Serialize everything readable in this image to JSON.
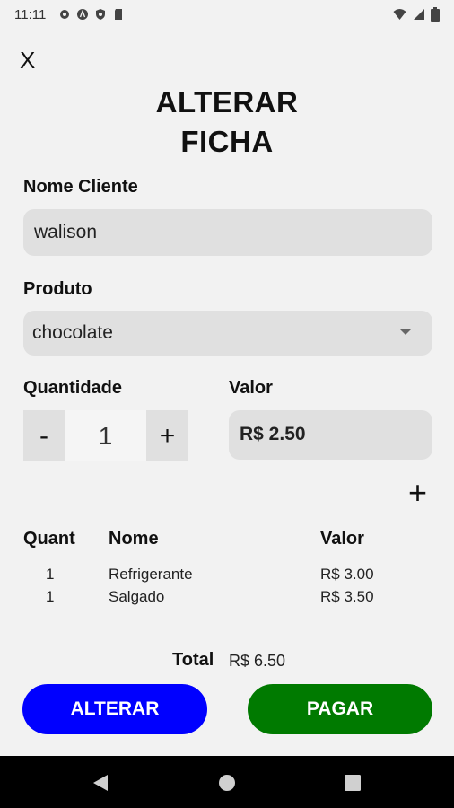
{
  "status_bar": {
    "time": "11:11"
  },
  "close_label": "X",
  "title_line1": "ALTERAR",
  "title_line2": "FICHA",
  "nome_cliente": {
    "label": "Nome Cliente",
    "value": "walison"
  },
  "produto": {
    "label": "Produto",
    "selected": "chocolate"
  },
  "quantidade": {
    "label": "Quantidade",
    "minus": "-",
    "value": "1",
    "plus": "+"
  },
  "valor": {
    "label": "Valor",
    "value": "R$ 2.50"
  },
  "add_label": "+",
  "table": {
    "headers": {
      "quant": "Quant",
      "nome": "Nome",
      "valor": "Valor"
    },
    "rows": [
      {
        "quant": "1",
        "nome": "Refrigerante",
        "valor": "R$ 3.00"
      },
      {
        "quant": "1",
        "nome": "Salgado",
        "valor": "R$ 3.50"
      }
    ]
  },
  "total": {
    "label": "Total",
    "value": "R$ 6.50"
  },
  "buttons": {
    "alterar": "ALTERAR",
    "pagar": "PAGAR"
  },
  "colors": {
    "alterar": "#0000ff",
    "pagar": "#007a00"
  }
}
